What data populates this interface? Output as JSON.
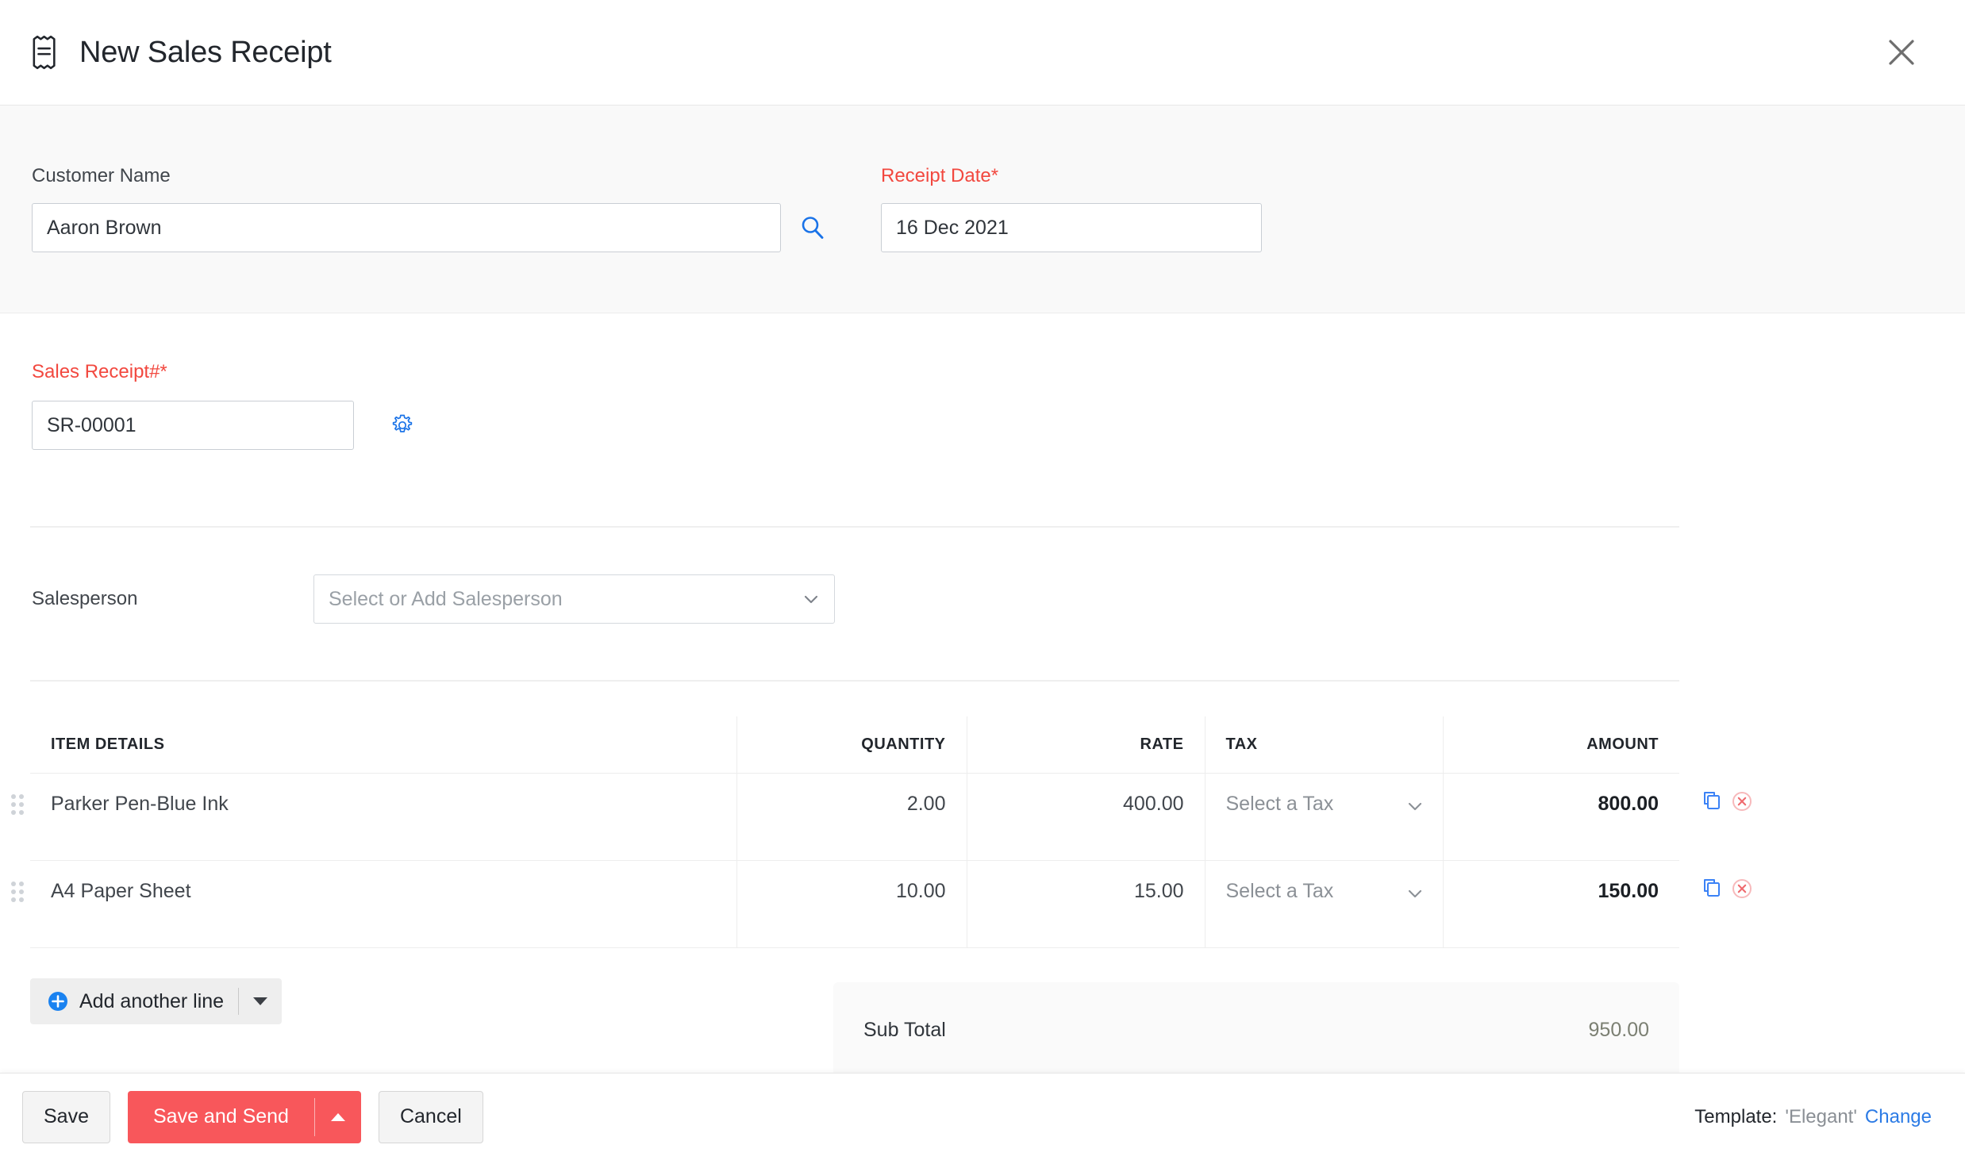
{
  "header": {
    "title": "New Sales Receipt",
    "icon": "receipt-icon",
    "close_icon": "close-icon"
  },
  "form": {
    "customer": {
      "label": "Customer Name",
      "value": "Aaron Brown",
      "placeholder": "Customer Name",
      "search_icon": "search-icon"
    },
    "receipt_date": {
      "label": "Receipt Date*",
      "value": "16 Dec 2021",
      "placeholder": "Date"
    },
    "receipt_no": {
      "label": "Sales Receipt#*",
      "value": "SR-00001",
      "placeholder": "Sales Receipt#",
      "settings_icon": "gear-icon"
    },
    "salesperson": {
      "label": "Salesperson",
      "placeholder": "Select or Add Salesperson",
      "value": "",
      "caret_icon": "chevron-down-icon"
    }
  },
  "items_table": {
    "columns": [
      "ITEM DETAILS",
      "QUANTITY",
      "RATE",
      "TAX",
      "AMOUNT"
    ],
    "rows": [
      {
        "item": "Parker Pen-Blue Ink",
        "quantity": "2.00",
        "rate": "400.00",
        "tax": "Select a Tax",
        "amount": "800.00"
      },
      {
        "item": "A4 Paper Sheet",
        "quantity": "10.00",
        "rate": "15.00",
        "tax": "Select a Tax",
        "amount": "150.00"
      }
    ],
    "row_actions": {
      "copy_icon": "copy-icon",
      "delete_icon": "delete-circle-icon",
      "drag_icon": "drag-handle-icon"
    },
    "add_line": {
      "label": "Add another line",
      "plus_icon": "plus-circle-icon",
      "dropdown_icon": "caret-down-icon"
    }
  },
  "totals": {
    "sub_total_label": "Sub Total",
    "sub_total_value": "950.00"
  },
  "footer": {
    "save_label": "Save",
    "save_send_label": "Save and Send",
    "save_send_caret": "caret-up-icon",
    "cancel_label": "Cancel",
    "template_label": "Template:",
    "template_value": "'Elegant'",
    "template_change": "Change"
  },
  "colors": {
    "required_red": "#f2483f",
    "primary_red": "#f8575b",
    "link_blue": "#2c7be5",
    "accent_blue": "#1a73e8",
    "band_gray": "#f9f9f9"
  }
}
